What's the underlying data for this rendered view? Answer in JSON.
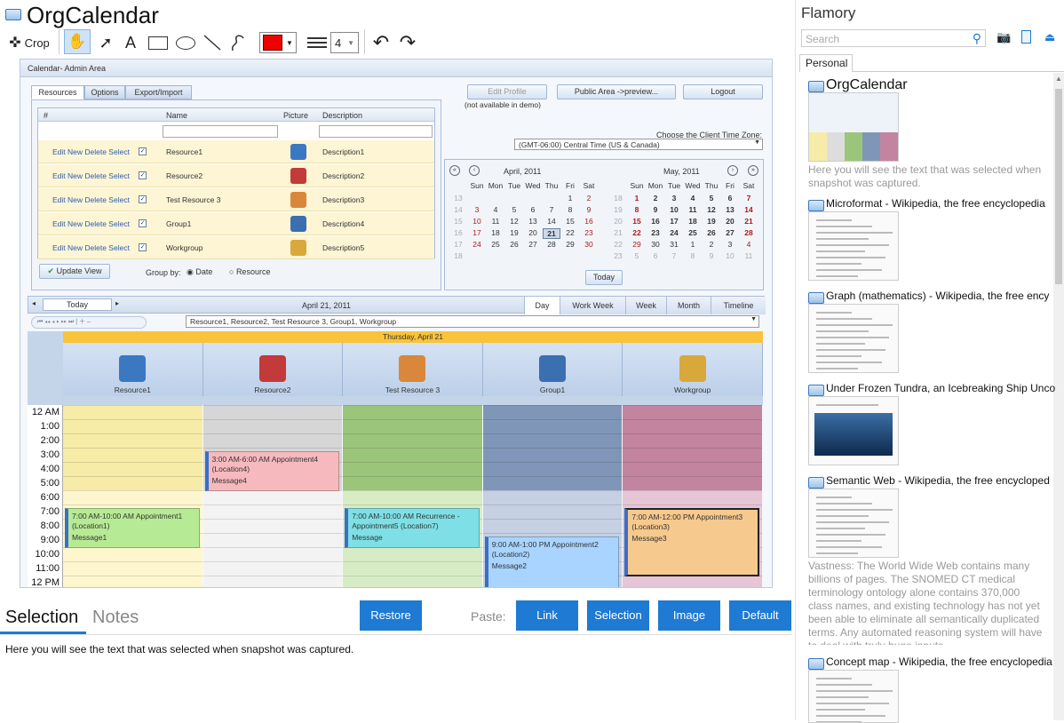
{
  "app": {
    "title": "OrgCalendar"
  },
  "toolbar": {
    "crop_label": "Crop",
    "text_tool": "A",
    "line_width": "4"
  },
  "colors": {
    "accent": "#1e7ad2",
    "pen": "#ee0000"
  },
  "screenshot": {
    "header": "Calendar- Admin Area",
    "tabs": [
      "Resources",
      "Options",
      "Export/Import"
    ],
    "buttons": {
      "edit_profile": "Edit Profile",
      "edit_note": "(not available in demo)",
      "public_area": "Public Area ->preview...",
      "logout": "Logout"
    },
    "table_headers": [
      "#",
      "Name",
      "Picture",
      "Description"
    ],
    "rows": [
      {
        "actions": "Edit New Delete Select",
        "name": "Resource1",
        "desc": "Description1"
      },
      {
        "actions": "Edit New Delete Select",
        "name": "Resource2",
        "desc": "Description2"
      },
      {
        "actions": "Edit New Delete Select",
        "name": "Test Resource 3",
        "desc": "Description3"
      },
      {
        "actions": "Edit New Delete Select",
        "name": "Group1",
        "desc": "Description4"
      },
      {
        "actions": "Edit New Delete Select",
        "name": "Workgroup",
        "desc": "Description5"
      }
    ],
    "update_view": "Update View",
    "group_by": "Group by:",
    "group_date": "Date",
    "group_resource": "Resource",
    "tz_label": "Choose the Client Time Zone:",
    "tz_value": "(GMT-06:00) Central Time (US & Canada)",
    "months": [
      "April, 2011",
      "May, 2011"
    ],
    "weekdays": [
      "Sun",
      "Mon",
      "Tue",
      "Wed",
      "Thu",
      "Fri",
      "Sat"
    ],
    "april_weeks": [
      [
        "13",
        "",
        "",
        "",
        "",
        "1",
        "2"
      ],
      [
        "14",
        "3",
        "4",
        "5",
        "6",
        "7",
        "8",
        "9"
      ],
      [
        "15",
        "10",
        "11",
        "12",
        "13",
        "14",
        "15",
        "16"
      ],
      [
        "16",
        "17",
        "18",
        "19",
        "20",
        "21",
        "22",
        "23"
      ],
      [
        "17",
        "24",
        "25",
        "26",
        "27",
        "28",
        "29",
        "30"
      ],
      [
        "18",
        "",
        "",
        "",
        "",
        "",
        "",
        ""
      ]
    ],
    "may_weeks": [
      [
        "18",
        "1",
        "2",
        "3",
        "4",
        "5",
        "6",
        "7"
      ],
      [
        "19",
        "8",
        "9",
        "10",
        "11",
        "12",
        "13",
        "14"
      ],
      [
        "20",
        "15",
        "16",
        "17",
        "18",
        "19",
        "20",
        "21"
      ],
      [
        "21",
        "22",
        "23",
        "24",
        "25",
        "26",
        "27",
        "28"
      ],
      [
        "22",
        "29",
        "30",
        "31",
        "1",
        "2",
        "3",
        "4"
      ],
      [
        "23",
        "5",
        "6",
        "7",
        "8",
        "9",
        "10",
        "11"
      ]
    ],
    "today_btn": "Today",
    "nav_today": "Today",
    "current_date": "April 21, 2011",
    "views": [
      "Day",
      "Work Week",
      "Week",
      "Month",
      "Timeline"
    ],
    "resource_filter": "Resource1, Resource2, Test Resource 3, Group1, Workgroup",
    "day_header": "Thursday, April 21",
    "resources": [
      "Resource1",
      "Resource2",
      "Test Resource 3",
      "Group1",
      "Workgroup"
    ],
    "times": [
      "12 AM",
      "1:00",
      "2:00",
      "3:00",
      "4:00",
      "5:00",
      "6:00",
      "7:00",
      "8:00",
      "9:00",
      "10:00",
      "11:00",
      "12 PM"
    ],
    "appointments": [
      {
        "title": "7:00 AM-10:00 AM Appointment1",
        "loc": "(Location1)",
        "msg": "Message1"
      },
      {
        "title": "3:00 AM-6:00 AM Appointment4",
        "loc": "(Location4)",
        "msg": "Message4"
      },
      {
        "title": "7:00 AM-10:00 AM Recurrence - Appointment5 (Location7)",
        "loc": "",
        "msg": "Message"
      },
      {
        "title": "9:00 AM-1:00 PM Appointment2",
        "loc": "(Location2)",
        "msg": "Message2"
      },
      {
        "title": "7:00 AM-12:00 PM Appointment3",
        "loc": "(Location3)",
        "msg": "Message3"
      }
    ]
  },
  "bottom": {
    "tabs": [
      "Selection",
      "Notes"
    ],
    "restore": "Restore",
    "paste_label": "Paste:",
    "paste_buttons": [
      "Link",
      "Selection",
      "Image",
      "Default"
    ],
    "selection_text": "Here you will see the text that was selected when snapshot was captured."
  },
  "right": {
    "title": "Flamory",
    "search_placeholder": "Search",
    "tab": "Personal",
    "items": [
      {
        "title": "OrgCalendar",
        "desc": "Here you will see the text that was selected when snapshot was captured."
      },
      {
        "title": "Microformat - Wikipedia, the free encyclopedia",
        "desc": ""
      },
      {
        "title": "Graph (mathematics) - Wikipedia, the free ency",
        "desc": ""
      },
      {
        "title": "Under Frozen Tundra, an Icebreaking Ship Unco",
        "desc": ""
      },
      {
        "title": "Semantic Web - Wikipedia, the free encycloped",
        "desc": "Vastness: The World Wide Web contains many billions of pages. The SNOMED CT medical terminology ontology alone contains 370,000 class names, and existing technology has not yet been able to eliminate all semantically duplicated terms. Any automated reasoning system will have to deal with truly huge inputs."
      },
      {
        "title": "Concept map - Wikipedia, the free encyclopedia",
        "desc": ""
      }
    ]
  }
}
